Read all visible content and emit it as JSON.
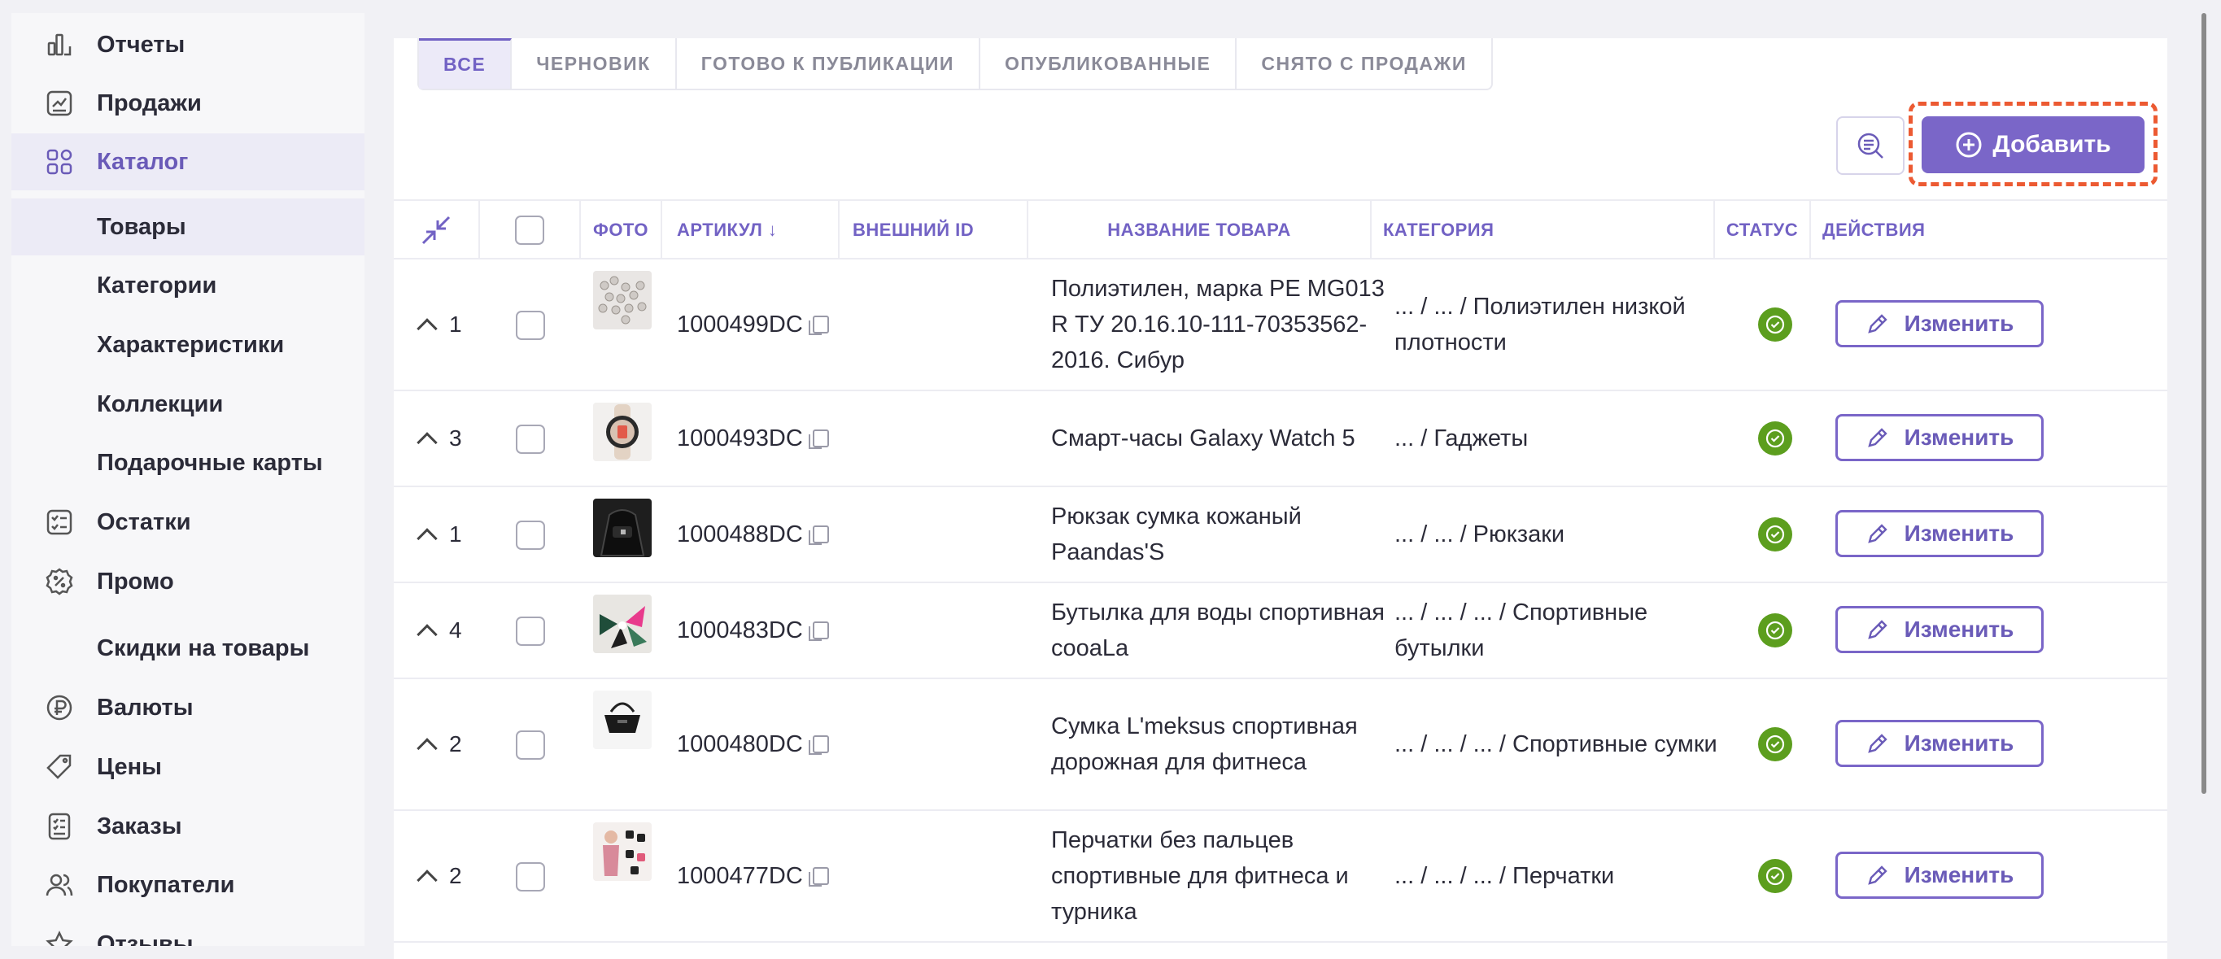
{
  "sidebar": {
    "items": [
      {
        "label": "Отчеты",
        "icon": "chart-bar-icon"
      },
      {
        "label": "Продажи",
        "icon": "sales-chart-icon"
      },
      {
        "label": "Каталог",
        "icon": "catalog-grid-icon"
      },
      {
        "label": "Товары"
      },
      {
        "label": "Категории"
      },
      {
        "label": "Характеристики"
      },
      {
        "label": "Коллекции"
      },
      {
        "label": "Подарочные карты"
      },
      {
        "label": "Остатки",
        "icon": "checklist-icon"
      },
      {
        "label": "Промо",
        "icon": "percent-badge-icon"
      },
      {
        "label": "Скидки на товары"
      },
      {
        "label": "Валюты",
        "icon": "ruble-coin-icon"
      },
      {
        "label": "Цены",
        "icon": "price-tag-icon"
      },
      {
        "label": "Заказы",
        "icon": "receipt-icon"
      },
      {
        "label": "Покупатели",
        "icon": "users-icon"
      },
      {
        "label": "Отзывы",
        "icon": "star-icon"
      }
    ]
  },
  "tabs": [
    {
      "label": "ВСЕ",
      "active": true
    },
    {
      "label": "ЧЕРНОВИК"
    },
    {
      "label": "ГОТОВО К ПУБЛИКАЦИИ"
    },
    {
      "label": "ОПУБЛИКОВАННЫЕ"
    },
    {
      "label": "СНЯТО С ПРОДАЖИ"
    }
  ],
  "toolbar": {
    "add_label": "Добавить",
    "highlight_color": "#ec5a32",
    "accent": "#7a66c8"
  },
  "table": {
    "headers": {
      "photo": "ФОТО",
      "sku": "АРТИКУЛ ↓",
      "external_id": "ВНЕШНИЙ ID",
      "name": "НАЗВАНИЕ ТОВАРА",
      "category": "КАТЕГОРИЯ",
      "status": "СТАТУС",
      "actions": "ДЕЙСТВИЯ"
    },
    "rows": [
      {
        "count": "1",
        "sku": "1000499DC",
        "name": "Полиэтилен, марка PE MG013 R ТУ 20.16.10-111-70353562-2016. Сибур",
        "category": "... / ... / Полиэтилен низкой плотности",
        "edit": "Изменить"
      },
      {
        "count": "3",
        "sku": "1000493DC",
        "name": "Смарт-часы Galaxy Watch 5",
        "category": "... / Гаджеты",
        "edit": "Изменить"
      },
      {
        "count": "1",
        "sku": "1000488DC",
        "name": "Рюкзак сумка кожаный Paandas'S",
        "category": "... / ... / Рюкзаки",
        "edit": "Изменить"
      },
      {
        "count": "4",
        "sku": "1000483DC",
        "name": "Бутылка для воды спортивная cooaLa",
        "category": "... / ... / ... / Спортивные бутылки",
        "edit": "Изменить"
      },
      {
        "count": "2",
        "sku": "1000480DC",
        "name": "Сумка L'meksus спортивная дорожная для фитнеса",
        "category": "... / ... / ... / Спортивные сумки",
        "edit": "Изменить"
      },
      {
        "count": "2",
        "sku": "1000477DC",
        "name": "Перчатки без пальцев спортивные для фитнеса и турника",
        "category": "... / ... / ... / Перчатки",
        "edit": "Изменить"
      }
    ]
  },
  "status_color": "#5c9e1e"
}
